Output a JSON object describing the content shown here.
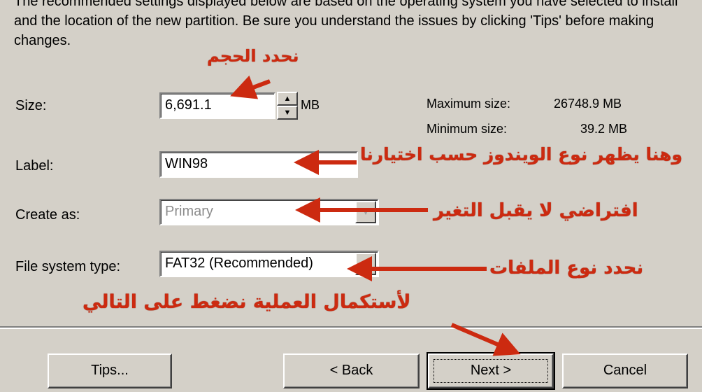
{
  "intro_text": "The recommended settings displayed below are based on the operating system you have selected to install and the location of the new partition. Be sure you understand the issues by clicking 'Tips' before making changes.",
  "form": {
    "size_label": "Size:",
    "size_value": "6,691.1",
    "size_unit": "MB",
    "max_label": "Maximum size:",
    "max_value": "26748.9 MB",
    "min_label": "Minimum size:",
    "min_value": "39.2 MB",
    "label_label": "Label:",
    "label_value": "WIN98",
    "create_label": "Create as:",
    "create_value": "Primary",
    "fs_label": "File system type:",
    "fs_value": "FAT32 (Recommended)"
  },
  "buttons": {
    "tips": "Tips...",
    "back": "< Back",
    "next": "Next >",
    "cancel": "Cancel"
  },
  "annotations": {
    "size": "نحدد الحجم",
    "label": "وهنا يظهر نوع الويندوز حسب اختيارنا",
    "create": "افتراضي لا يقبل التغير",
    "fs": "نحدد نوع الملفات",
    "next": "لأستكمال العملية نضغط على التالي"
  },
  "colors": {
    "annotation": "#cc2a10",
    "dialog_bg": "#d4d0c8"
  }
}
